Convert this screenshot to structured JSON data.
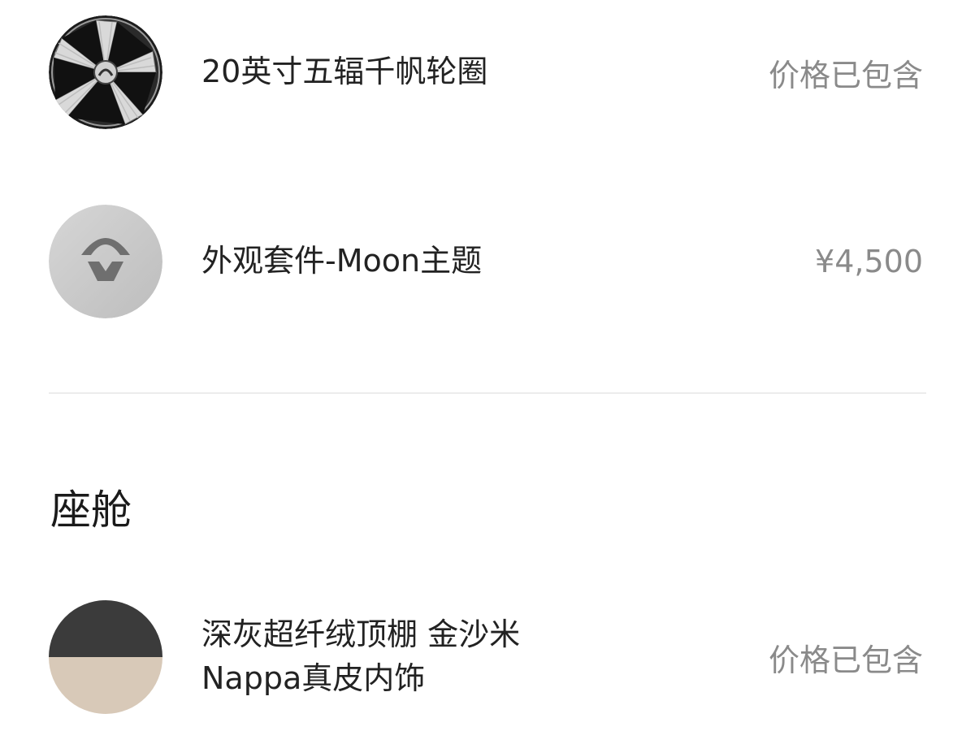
{
  "options": [
    {
      "icon": "wheel-rim-icon",
      "label": "20英寸五辐千帆轮圈",
      "price": "价格已包含"
    },
    {
      "icon": "nio-logo-icon",
      "label": "外观套件-Moon主题",
      "price": "¥4,500"
    }
  ],
  "cabin_section": {
    "title": "座舱",
    "items": [
      {
        "icon": "upholstery-swatch-icon",
        "label_line1": "深灰超纤绒顶棚 金沙米",
        "label_line2": "Nappa真皮内饰",
        "price": "价格已包含"
      }
    ]
  },
  "colors": {
    "price_text": "#8a8a8a",
    "divider": "#ececec",
    "headliner": "#3b3b3b",
    "leather": "#d8c9b8",
    "logo_disc": "#c9c9c9"
  }
}
